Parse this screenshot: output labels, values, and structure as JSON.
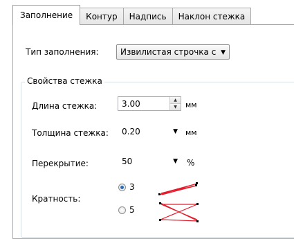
{
  "tabs": [
    "Заполнение",
    "Контур",
    "Надпись",
    "Наклон стежка"
  ],
  "fill": {
    "label": "Тип заполнения:",
    "value": "Извилистая строчка с во"
  },
  "group": {
    "title": "Свойства стежка",
    "length": {
      "label": "Длина стежка:",
      "value": "3.00",
      "unit": "мм"
    },
    "thickness": {
      "label": "Толщина стежка:",
      "value": "0.20",
      "unit": "мм"
    },
    "overlap": {
      "label": "Перекрытие:",
      "value": "50",
      "unit": "%"
    },
    "multiplicity": {
      "label": "Кратность:",
      "options": [
        {
          "value": "3",
          "checked": true
        },
        {
          "value": "5",
          "checked": false
        }
      ]
    }
  },
  "colors": {
    "stitch": "#e31e2c",
    "point": "#000000"
  }
}
